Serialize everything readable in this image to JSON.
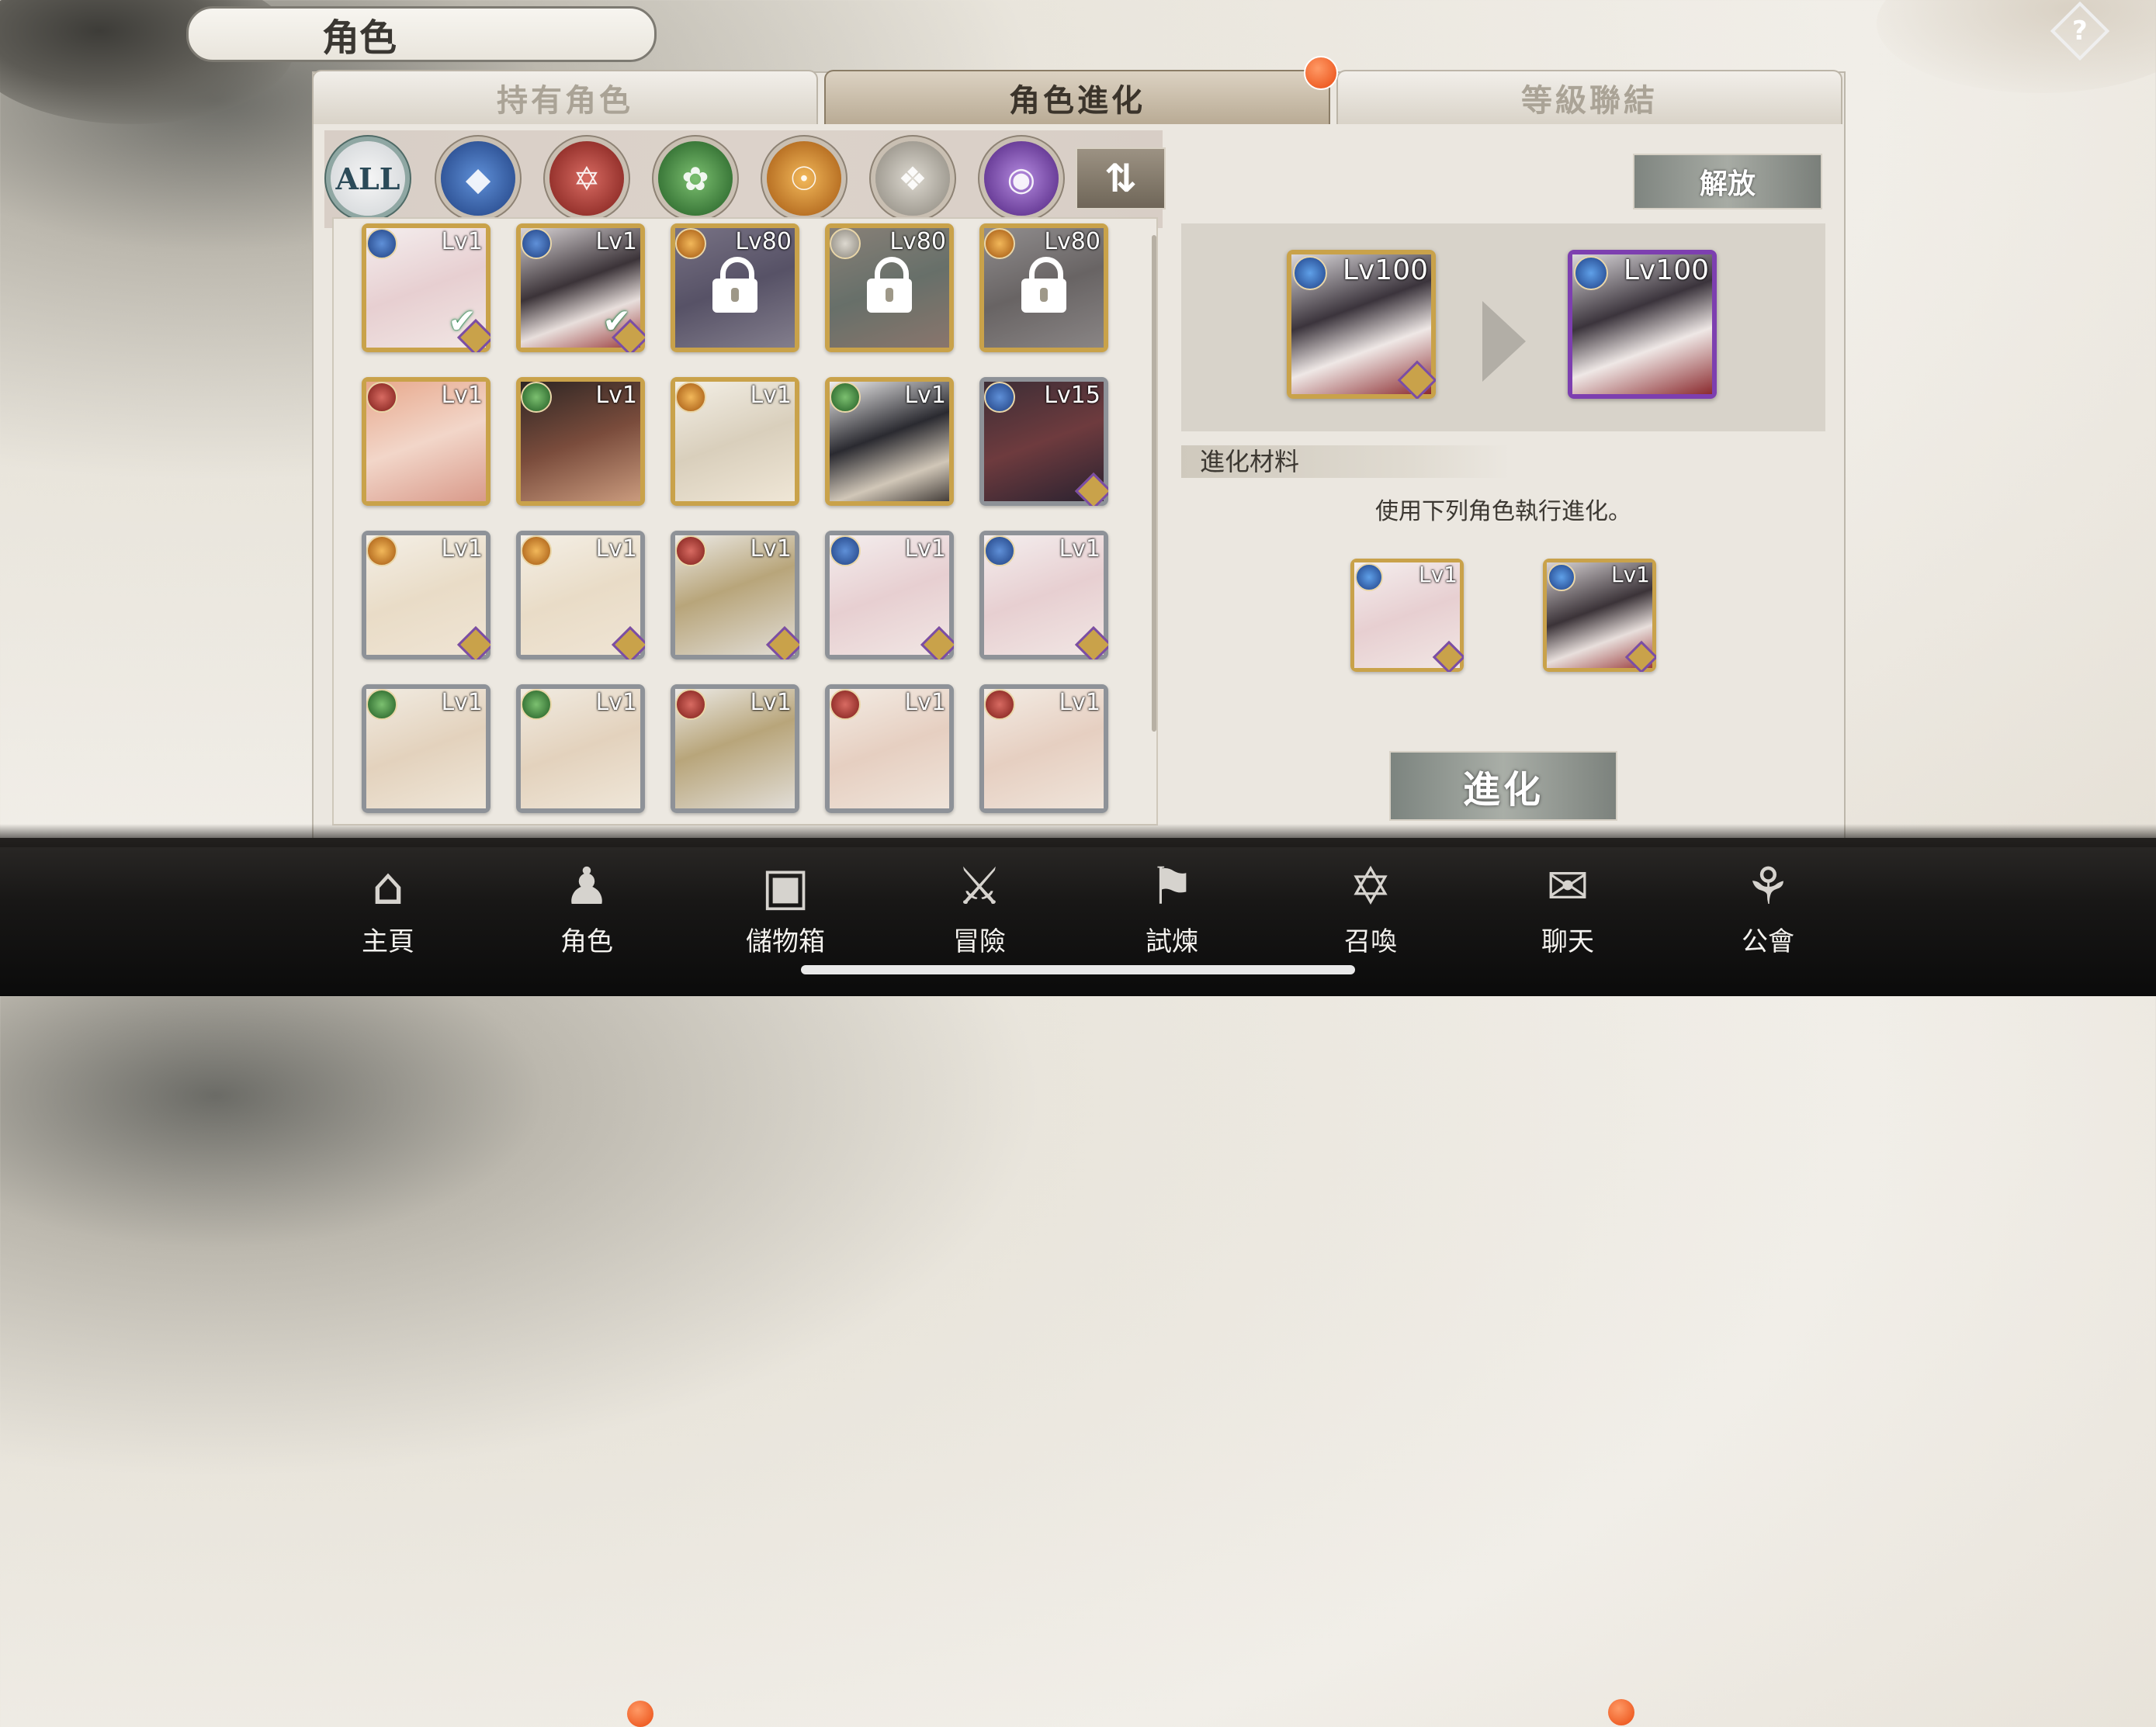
{
  "header": {
    "title": "角色"
  },
  "tabs": [
    {
      "label": "持有角色",
      "active": false
    },
    {
      "label": "角色進化",
      "active": true
    },
    {
      "label": "等級聯結",
      "active": false
    }
  ],
  "filters": [
    {
      "name": "all",
      "label": "ALL",
      "color": "#f2f2f2"
    },
    {
      "name": "water",
      "label": "",
      "color": "#2f5fae"
    },
    {
      "name": "fire",
      "label": "",
      "color": "#b8342e"
    },
    {
      "name": "wind",
      "label": "",
      "color": "#3f8a3b"
    },
    {
      "name": "light",
      "label": "",
      "color": "#d9861d"
    },
    {
      "name": "neutral",
      "label": "",
      "color": "#a7a49c"
    },
    {
      "name": "dark",
      "label": "",
      "color": "#7b4aa8"
    }
  ],
  "sort_icon": "sort-arrows-icon",
  "characters": [
    {
      "level": "Lv1",
      "element": "water",
      "frame": "gold",
      "checked": true,
      "locked": false
    },
    {
      "level": "Lv1",
      "element": "water",
      "frame": "gold",
      "checked": true,
      "locked": false
    },
    {
      "level": "Lv80",
      "element": "light",
      "frame": "gold",
      "checked": false,
      "locked": true
    },
    {
      "level": "Lv80",
      "element": "neutral",
      "frame": "gold",
      "checked": false,
      "locked": true
    },
    {
      "level": "Lv80",
      "element": "light",
      "frame": "gold",
      "checked": false,
      "locked": true
    },
    {
      "level": "Lv1",
      "element": "fire",
      "frame": "gold",
      "checked": false,
      "locked": false
    },
    {
      "level": "Lv1",
      "element": "wind",
      "frame": "gold",
      "checked": false,
      "locked": false
    },
    {
      "level": "Lv1",
      "element": "light",
      "frame": "gold",
      "checked": false,
      "locked": false
    },
    {
      "level": "Lv1",
      "element": "wind",
      "frame": "gold",
      "checked": false,
      "locked": false
    },
    {
      "level": "Lv15",
      "element": "water",
      "frame": "silver",
      "checked": false,
      "locked": false
    },
    {
      "level": "Lv1",
      "element": "light",
      "frame": "silver",
      "checked": false,
      "locked": false
    },
    {
      "level": "Lv1",
      "element": "light",
      "frame": "silver",
      "checked": false,
      "locked": false
    },
    {
      "level": "Lv1",
      "element": "fire",
      "frame": "silver",
      "checked": false,
      "locked": false
    },
    {
      "level": "Lv1",
      "element": "water",
      "frame": "silver",
      "checked": false,
      "locked": false
    },
    {
      "level": "Lv1",
      "element": "water",
      "frame": "silver",
      "checked": false,
      "locked": false
    },
    {
      "level": "Lv1",
      "element": "wind",
      "frame": "silver",
      "checked": false,
      "locked": false
    },
    {
      "level": "Lv1",
      "element": "wind",
      "frame": "silver",
      "checked": false,
      "locked": false
    },
    {
      "level": "Lv1",
      "element": "fire",
      "frame": "silver",
      "checked": false,
      "locked": false
    },
    {
      "level": "Lv1",
      "element": "fire",
      "frame": "silver",
      "checked": false,
      "locked": false
    },
    {
      "level": "Lv1",
      "element": "fire",
      "frame": "silver",
      "checked": false,
      "locked": false
    }
  ],
  "evolution": {
    "release_label": "解放",
    "before": {
      "level": "Lv100",
      "element": "water",
      "frame": "gold"
    },
    "after": {
      "level": "Lv100",
      "element": "water",
      "frame": "purple"
    },
    "materials_title": "進化材料",
    "instruction": "使用下列角色執行進化。",
    "materials": [
      {
        "level": "Lv1",
        "element": "water"
      },
      {
        "level": "Lv1",
        "element": "water"
      }
    ],
    "evolve_label": "進化"
  },
  "bottom_nav": [
    {
      "label": "主頁",
      "icon": "home-icon",
      "badge": false
    },
    {
      "label": "角色",
      "icon": "characters-icon",
      "badge": true
    },
    {
      "label": "儲物箱",
      "icon": "storage-box-icon",
      "badge": false
    },
    {
      "label": "冒險",
      "icon": "crossed-swords-icon",
      "badge": false
    },
    {
      "label": "試煉",
      "icon": "flag-icon",
      "badge": false
    },
    {
      "label": "召喚",
      "icon": "summon-circle-icon",
      "badge": false
    },
    {
      "label": "聊天",
      "icon": "chat-bubble-icon",
      "badge": true
    },
    {
      "label": "公會",
      "icon": "guild-trident-icon",
      "badge": false
    }
  ],
  "colors": {
    "element_water": "#2f5fae",
    "element_fire": "#b8342e",
    "element_wind": "#3f8a3b",
    "element_light": "#d9861d",
    "element_neutral": "#a7a49c",
    "element_dark": "#7b4aa8",
    "badge": "#e94a10"
  }
}
